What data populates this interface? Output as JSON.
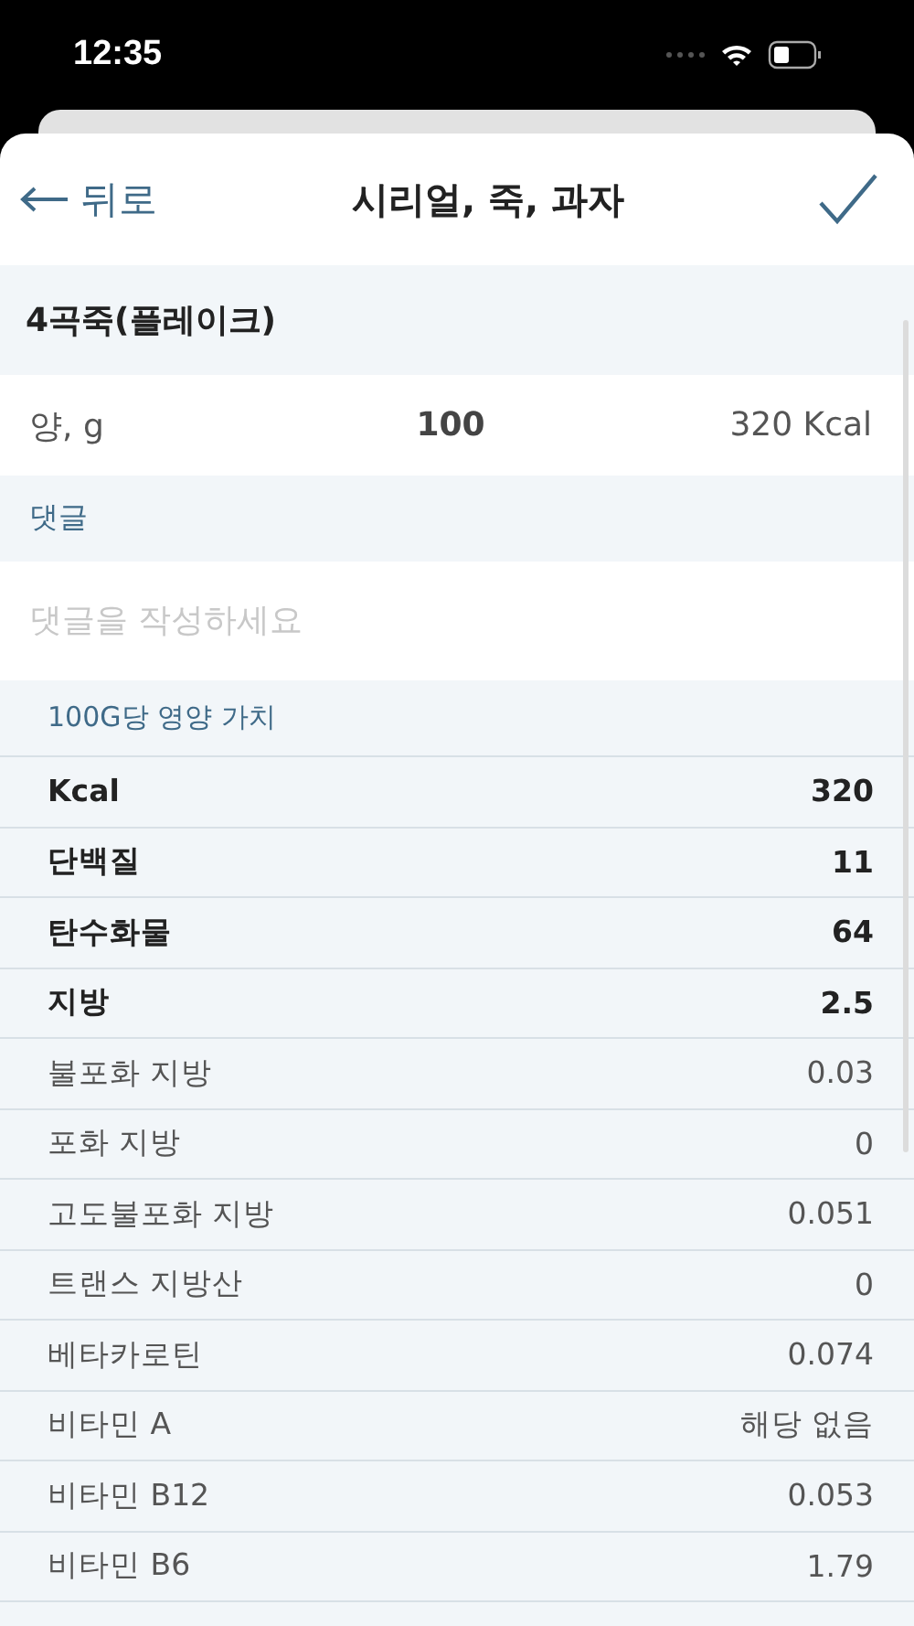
{
  "status_bar": {
    "time": "12:35"
  },
  "nav": {
    "back": "뒤로",
    "title": "시리얼, 죽, 과자"
  },
  "food": {
    "name": "4곡죽(플레이크)"
  },
  "amount": {
    "label": "양, g",
    "value": "100",
    "energy": "320 Kcal"
  },
  "comment": {
    "heading": "댓글",
    "placeholder": "댓글을 작성하세요"
  },
  "nutrition": {
    "heading": "100G당 영양 가치",
    "rows": [
      {
        "name": "Kcal",
        "value": "320",
        "bold": true
      },
      {
        "name": "단백질",
        "value": "11",
        "bold": true
      },
      {
        "name": "탄수화물",
        "value": "64",
        "bold": true
      },
      {
        "name": "지방",
        "value": "2.5",
        "bold": true
      },
      {
        "name": "불포화 지방",
        "value": "0.03",
        "bold": false
      },
      {
        "name": "포화 지방",
        "value": "0",
        "bold": false
      },
      {
        "name": "고도불포화 지방",
        "value": "0.051",
        "bold": false
      },
      {
        "name": "트랜스 지방산",
        "value": "0",
        "bold": false
      },
      {
        "name": "베타카로틴",
        "value": "0.074",
        "bold": false
      },
      {
        "name": "비타민 A",
        "value": "해당 없음",
        "bold": false
      },
      {
        "name": "비타민 B12",
        "value": "0.053",
        "bold": false
      },
      {
        "name": "비타민 B6",
        "value": "1.79",
        "bold": false
      }
    ]
  }
}
